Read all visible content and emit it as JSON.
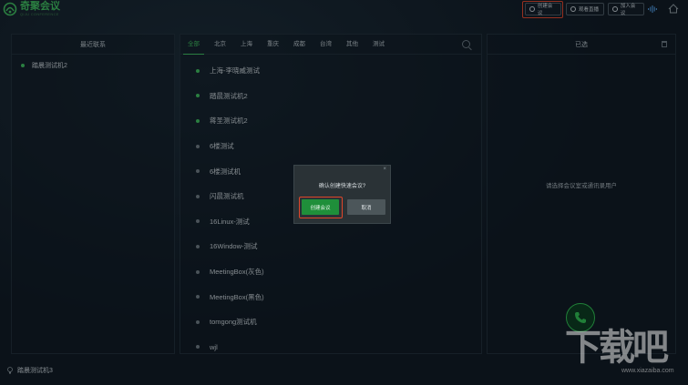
{
  "app": {
    "title": "奇聚会议",
    "subtitle": "QIJU CONFERENCE"
  },
  "toolbar": {
    "create_meeting": "创建会议",
    "start_live": "观看直播",
    "join_meeting": "加入会议"
  },
  "left_panel": {
    "title": "最近联系",
    "items": [
      {
        "label": "踏晨测试机2"
      }
    ]
  },
  "mid_panel": {
    "tabs": [
      {
        "label": "全部",
        "active": true
      },
      {
        "label": "北京"
      },
      {
        "label": "上海"
      },
      {
        "label": "重庆"
      },
      {
        "label": "成都"
      },
      {
        "label": "台湾"
      },
      {
        "label": "其他"
      },
      {
        "label": "测试"
      }
    ],
    "items": [
      {
        "label": "上海-李晓威测试",
        "online": true
      },
      {
        "label": "踏晨测试机2",
        "online": true
      },
      {
        "label": "蒋圣测试机2",
        "online": true
      },
      {
        "label": "6楼测试",
        "online": false
      },
      {
        "label": "6楼测试机",
        "online": false
      },
      {
        "label": "闪晨测试机",
        "online": false
      },
      {
        "label": "16Linux-测试",
        "online": false
      },
      {
        "label": "16Window-测试",
        "online": false
      },
      {
        "label": "MeetingBox(灰色)",
        "online": false
      },
      {
        "label": "MeetingBox(黑色)",
        "online": false
      },
      {
        "label": "tomgong测试机",
        "online": false
      },
      {
        "label": "wjl",
        "online": false
      }
    ]
  },
  "right_panel": {
    "title": "已选",
    "empty_text": "请选择会议室或通讯录用户"
  },
  "bottom": {
    "current_user": "踏晨测试机3"
  },
  "dialog": {
    "message": "确认创建快速会议?",
    "confirm_label": "创建会议",
    "cancel_label": "取消",
    "close_glyph": "×"
  },
  "watermark": {
    "text": "下载吧",
    "url": "www.xiazaiba.com"
  },
  "colors": {
    "accent": "#3fbf5c",
    "highlight": "#e0462a",
    "background": "#0e1820"
  }
}
